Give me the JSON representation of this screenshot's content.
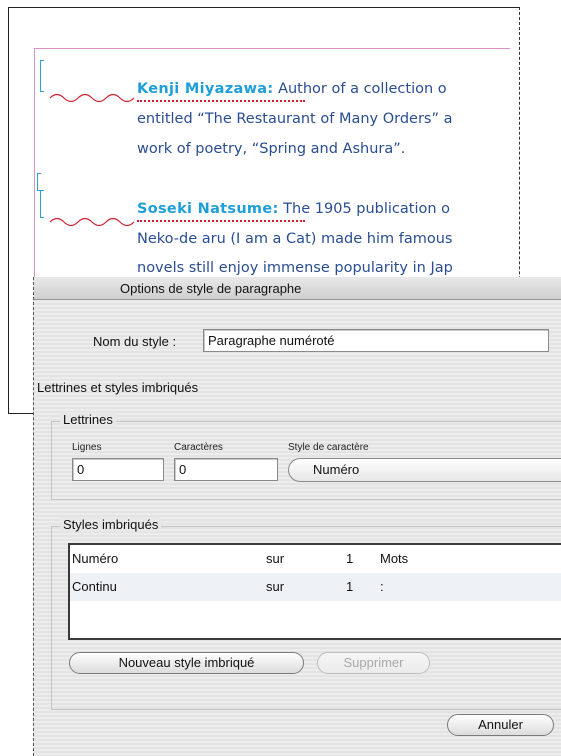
{
  "document": {
    "entries": [
      {
        "name": "Kenji Miyazawa:",
        "lines": [
          " Author of a collection o",
          "entitled “The Restaurant of Many Orders” a",
          "work of poetry, “Spring and Ashura”."
        ]
      },
      {
        "name": "Soseki Natsume:",
        "lines": [
          " The 1905 publication o",
          "Neko-de aru (I am a Cat) made him famous",
          "novels still enjoy immense popularity in Jap"
        ]
      }
    ],
    "colors": {
      "body_text": "#2a4d93",
      "nested_style": "#1e9fd9",
      "margin_guide": "#d98fc7",
      "underline": "#d0202c"
    }
  },
  "dialog": {
    "title": "Options de style de paragraphe",
    "style_name_label": "Nom du style :",
    "style_name_value": "Paragraphe numéroté",
    "section_title": "Lettrines et styles imbriqués",
    "drop_caps": {
      "title": "Lettrines",
      "lines_label": "Lignes",
      "lines_value": "0",
      "chars_label": "Caractères",
      "chars_value": "0",
      "char_style_label": "Style de caractère",
      "char_style_value": "Numéro"
    },
    "nested_styles": {
      "title": "Styles imbriqués",
      "rows": [
        {
          "style": "Numéro",
          "through": "sur",
          "count": "1",
          "unit": "Mots"
        },
        {
          "style": "Continu",
          "through": "sur",
          "count": "1",
          "unit": ":"
        }
      ],
      "new_button": "Nouveau style imbriqué",
      "delete_button": "Supprimer"
    },
    "cancel_button": "Annuler"
  }
}
